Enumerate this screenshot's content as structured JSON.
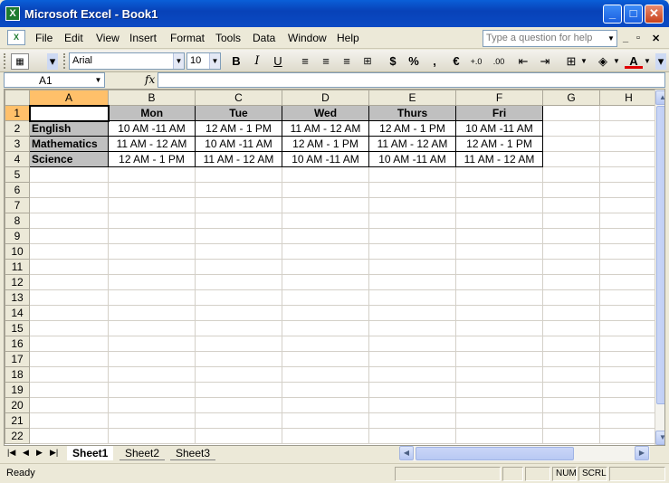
{
  "window": {
    "title": "Microsoft Excel - Book1",
    "minimize": "_",
    "maximize": "□",
    "close": "✕"
  },
  "menu": [
    "File",
    "Edit",
    "View",
    "Insert",
    "Format",
    "Tools",
    "Data",
    "Window",
    "Help"
  ],
  "ask_placeholder": "Type a question for help",
  "toolbar": {
    "font": "Arial",
    "size": "10",
    "bold": "B",
    "italic": "I",
    "underline": "U",
    "currency": "$",
    "percent": "%",
    "comma": ",",
    "euro": "€",
    "inc_decimal": "+.0",
    "dec_decimal": ".00"
  },
  "formula": {
    "name_box": "A1",
    "fx": "fx",
    "value": ""
  },
  "columns": [
    "A",
    "B",
    "C",
    "D",
    "E",
    "F",
    "G",
    "H"
  ],
  "table": {
    "headers": [
      "",
      "Mon",
      "Tue",
      "Wed",
      "Thurs",
      "Fri"
    ],
    "rows": [
      {
        "subject": "English",
        "times": [
          "10 AM -11 AM",
          "12 AM - 1 PM",
          "11 AM - 12 AM",
          "12 AM - 1 PM",
          "10 AM -11 AM"
        ]
      },
      {
        "subject": "Mathematics",
        "times": [
          "11 AM - 12 AM",
          "10 AM -11 AM",
          "12 AM - 1 PM",
          "11 AM - 12 AM",
          "12 AM - 1 PM"
        ]
      },
      {
        "subject": "Science",
        "times": [
          "12 AM - 1 PM",
          "11 AM - 12 AM",
          "10 AM -11 AM",
          "10 AM -11 AM",
          "11 AM - 12 AM"
        ]
      }
    ]
  },
  "row_count": 22,
  "sheets": [
    "Sheet1",
    "Sheet2",
    "Sheet3"
  ],
  "status": {
    "text": "Ready",
    "num": "NUM",
    "scrl": "SCRL"
  }
}
